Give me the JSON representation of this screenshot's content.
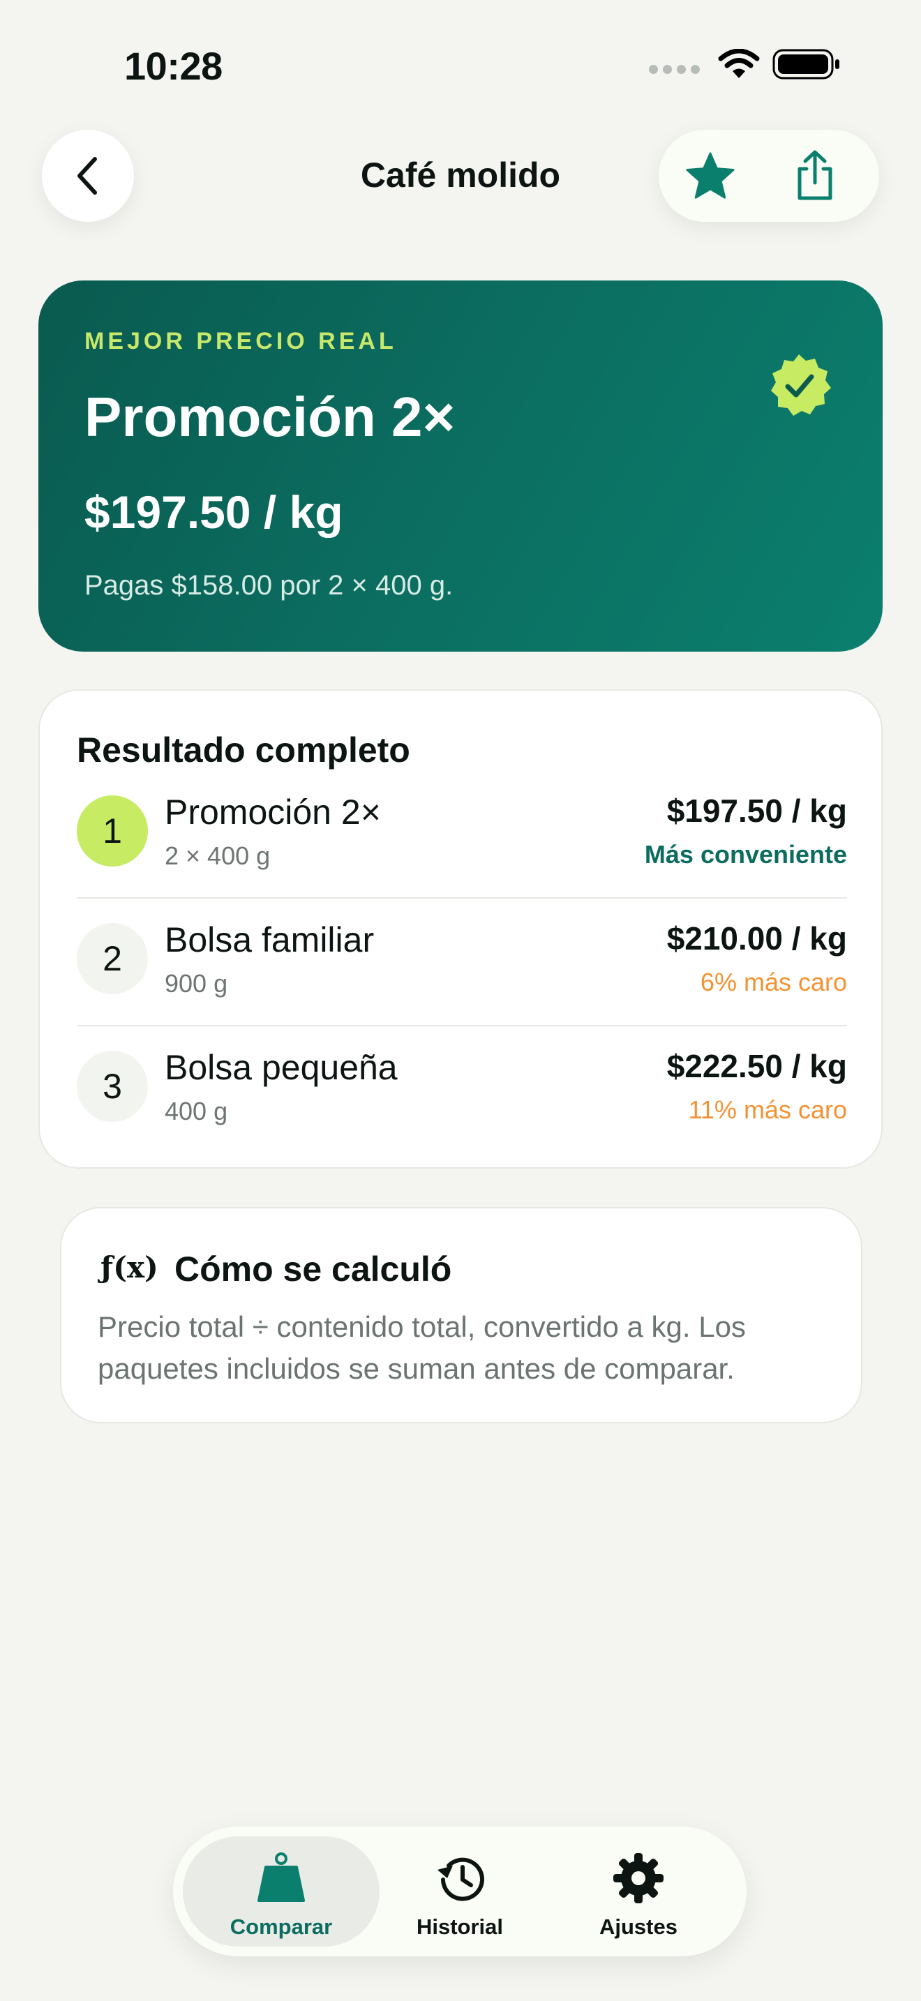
{
  "status_bar": {
    "time": "10:28"
  },
  "header": {
    "title": "Café molido"
  },
  "hero": {
    "eyebrow": "MEJOR PRECIO REAL",
    "title": "Promoción 2×",
    "price": "$197.50 / kg",
    "note": "Pagas $158.00 por 2 × 400 g."
  },
  "results": {
    "heading": "Resultado completo",
    "rows": [
      {
        "rank": "1",
        "name": "Promoción 2×",
        "qty": "2 × 400 g",
        "price": "$197.50 / kg",
        "tag": "Más conveniente"
      },
      {
        "rank": "2",
        "name": "Bolsa familiar",
        "qty": "900 g",
        "price": "$210.00 / kg",
        "tag": "6% más caro"
      },
      {
        "rank": "3",
        "name": "Bolsa pequeña",
        "qty": "400 g",
        "price": "$222.50 / kg",
        "tag": "11% más caro"
      }
    ]
  },
  "formula": {
    "symbol": "ƒ(x)",
    "title": "Cómo se calculó",
    "body": "Precio total ÷ contenido total, convertido a kg. Los paquetes incluidos se suman antes de comparar."
  },
  "tabbar": {
    "items": [
      {
        "label": "Comparar",
        "icon": "scale-weight-icon"
      },
      {
        "label": "Historial",
        "icon": "history-clock-icon"
      },
      {
        "label": "Ajustes",
        "icon": "gear-icon"
      }
    ]
  },
  "colors": {
    "accent": "#0b6c5f",
    "lime": "#c8eb64",
    "warning": "#f39233",
    "background": "#f4f5f1"
  }
}
